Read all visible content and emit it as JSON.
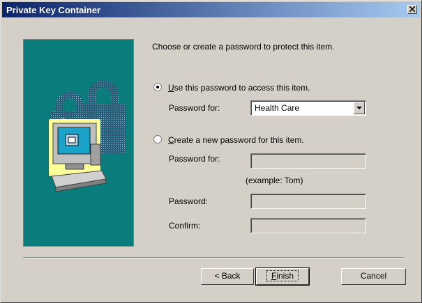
{
  "window": {
    "title": "Private Key Container"
  },
  "intro_text": "Choose or create a password to protect this item.",
  "option_use": {
    "label_prefix": "U",
    "label_rest": "se this password to access this item.",
    "selected": true,
    "password_for_label": "Password for:",
    "password_for_value": "Health Care"
  },
  "option_create": {
    "label_prefix": "C",
    "label_rest": "reate a new password for this item.",
    "selected": false,
    "password_for_label": "Password for:",
    "example_hint": "(example: Tom)",
    "password_label": "Password:",
    "confirm_label": "Confirm:"
  },
  "buttons": {
    "back": "< Back",
    "finish_prefix": "F",
    "finish_rest": "inish",
    "cancel": "Cancel"
  },
  "icons": [
    "close-icon",
    "padlock-icon",
    "computer-icon",
    "dropdown-arrow-icon"
  ],
  "colors": {
    "title_start": "#0a246a",
    "title_end": "#a6caf0",
    "art_bg": "#0a7c7c",
    "face": "#d4d0c8"
  }
}
